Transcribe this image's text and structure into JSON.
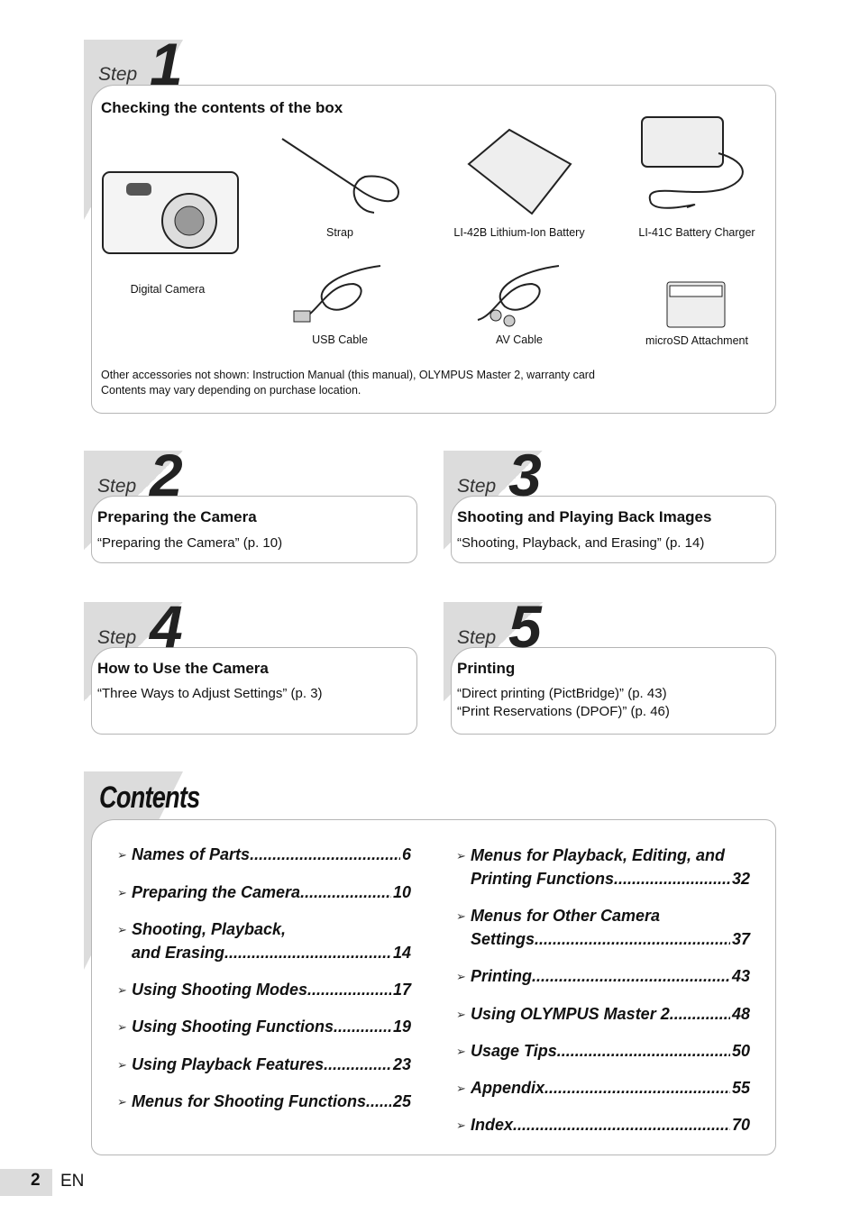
{
  "step_word": "Step",
  "step1": {
    "number": "1",
    "title": "Checking the contents of the box",
    "items": [
      {
        "label": "Digital Camera",
        "icon": "camera-icon"
      },
      {
        "label": "Strap",
        "icon": "strap-icon"
      },
      {
        "label": "LI-42B Lithium-Ion Battery",
        "icon": "battery-icon"
      },
      {
        "label": "LI-41C Battery Charger",
        "icon": "charger-icon"
      },
      {
        "label": "USB Cable",
        "icon": "usb-cable-icon"
      },
      {
        "label": "AV Cable",
        "icon": "av-cable-icon"
      },
      {
        "label": "microSD Attachment",
        "icon": "microsd-attachment-icon"
      }
    ],
    "note1": "Other accessories not shown: Instruction Manual (this manual), OLYMPUS Master 2, warranty card",
    "note2": "Contents may vary depending on purchase location."
  },
  "step2": {
    "number": "2",
    "title": "Preparing the Camera",
    "refs": [
      "“Preparing the Camera” (p. 10)"
    ]
  },
  "step3": {
    "number": "3",
    "title": "Shooting and Playing Back Images",
    "refs": [
      "“Shooting, Playback, and Erasing” (p. 14)"
    ]
  },
  "step4": {
    "number": "4",
    "title": "How to Use the Camera",
    "refs": [
      "“Three Ways to Adjust Settings” (p. 3)"
    ]
  },
  "step5": {
    "number": "5",
    "title": "Printing",
    "refs": [
      "“Direct printing (PictBridge)” (p. 43)",
      "“Print Reservations (DPOF)” (p. 46)"
    ]
  },
  "contents": {
    "title": "Contents",
    "left": [
      {
        "l1": "Names of Parts",
        "page": "6"
      },
      {
        "l1": "Preparing the Camera",
        "page": "10"
      },
      {
        "l0": "Shooting, Playback,",
        "l1": "and Erasing",
        "page": "14"
      },
      {
        "l1": "Using Shooting Modes",
        "page": "17"
      },
      {
        "l1": "Using Shooting Functions",
        "page": "19"
      },
      {
        "l1": "Using Playback Features",
        "page": "23"
      },
      {
        "l1": "Menus for Shooting Functions",
        "page": "25"
      }
    ],
    "right": [
      {
        "l0": "Menus for Playback, Editing, and",
        "l1": "Printing Functions",
        "page": "32"
      },
      {
        "l0": "Menus for Other Camera",
        "l1": "Settings",
        "page": "37"
      },
      {
        "l1": "Printing",
        "page": "43"
      },
      {
        "l1": "Using OLYMPUS Master 2",
        "page": "48"
      },
      {
        "l1": "Usage Tips",
        "page": "50"
      },
      {
        "l1": "Appendix",
        "page": "55"
      },
      {
        "l1": "Index",
        "page": "70"
      }
    ]
  },
  "footer": {
    "page_number": "2",
    "language": "EN"
  }
}
